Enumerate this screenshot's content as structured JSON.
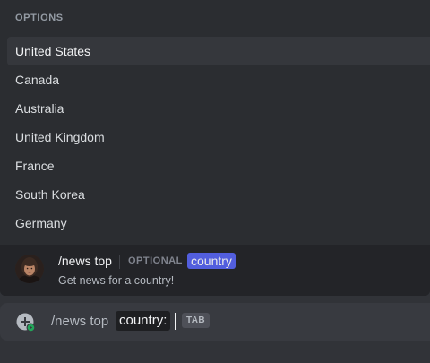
{
  "popup": {
    "options_header": "OPTIONS",
    "options": [
      {
        "label": "United States",
        "selected": true
      },
      {
        "label": "Canada",
        "selected": false
      },
      {
        "label": "Australia",
        "selected": false
      },
      {
        "label": "United Kingdom",
        "selected": false
      },
      {
        "label": "France",
        "selected": false
      },
      {
        "label": "South Korea",
        "selected": false
      },
      {
        "label": "Germany",
        "selected": false
      }
    ],
    "command": {
      "name": "/news top",
      "optional_label": "OPTIONAL",
      "param": "country",
      "description": "Get news for a country!",
      "avatar_icon": "user-avatar"
    }
  },
  "chatbar": {
    "add_icon": "plus-circle-icon",
    "command_text": "/news top",
    "param_text": "country:",
    "tab_hint": "TAB"
  },
  "colors": {
    "background": "#313338",
    "popup": "#2b2d31",
    "selected_row": "#35373c",
    "accent": "#5865f2",
    "online": "#23a55a"
  }
}
